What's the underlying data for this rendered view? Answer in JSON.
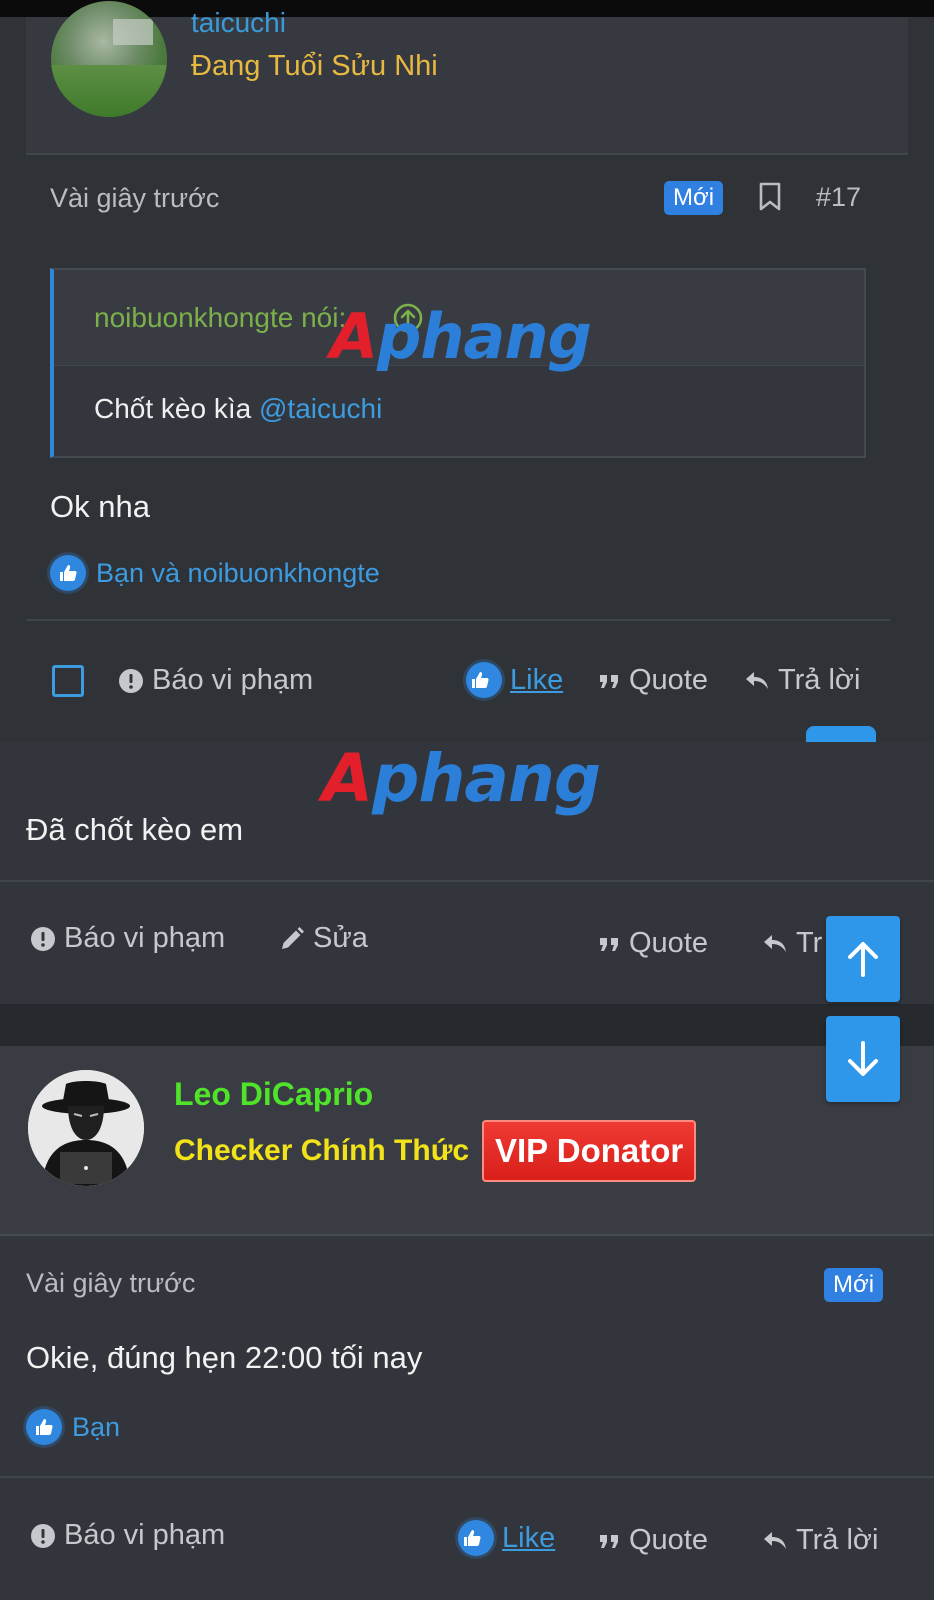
{
  "post17": {
    "author_name": "taicuchi",
    "author_title": "Đang Tuổi Sửu Nhi",
    "time": "Vài giây trước",
    "new_badge": "Mới",
    "post_number": "#17",
    "quote": {
      "author": "noibuonkhongte nói:",
      "text": "Chốt kèo kìa ",
      "mention": "@taicuchi"
    },
    "body": "Ok nha",
    "likes": "Bạn và noibuonkhongte",
    "actions": {
      "report": "Báo vi phạm",
      "like": "Like",
      "quote": "Quote",
      "reply": "Trả lời"
    }
  },
  "post18": {
    "body": "Đã chốt kèo em",
    "actions": {
      "report": "Báo vi phạm",
      "edit": "Sửa",
      "quote": "Quote",
      "reply": "Tr"
    }
  },
  "post19": {
    "author_name": "Leo DiCaprio",
    "author_title": "Checker Chính Thức",
    "vip_badge": "VIP Donator",
    "time": "Vài giây trước",
    "new_badge": "Mới",
    "body": "Okie, đúng hẹn 22:00 tối nay",
    "likes": "Bạn",
    "actions": {
      "report": "Báo vi phạm",
      "like": "Like",
      "quote": "Quote",
      "reply": "Trả lời"
    }
  },
  "watermark": {
    "first": "A",
    "rest": "phang"
  },
  "colors": {
    "background": "#2f3237",
    "accent_blue": "#2f87e0",
    "title_gold": "#e8b940",
    "name_green": "#4fe32a",
    "title_yellow": "#f2e21a",
    "vip_red": "#e02a24"
  }
}
